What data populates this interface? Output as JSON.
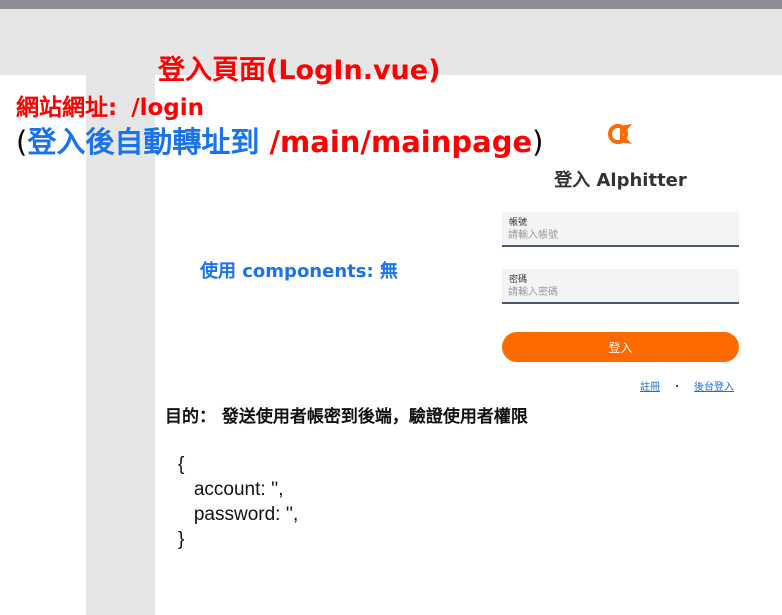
{
  "page": {
    "title": "登入頁面(LogIn.vue)",
    "url_label": "網站網址:",
    "url_value": "/login",
    "redirect_open": "(",
    "redirect_text": "登入後自動轉址到",
    "redirect_path": "/main/mainpage",
    "redirect_close": ")",
    "components_note": "使用 components: 無",
    "purpose": "目的： 發送使用者帳密到後端，驗證使用者權限",
    "code_lines": [
      "{",
      "   account: '',",
      "   password: '',",
      "}"
    ]
  },
  "login": {
    "logo_icon": "alphitter-logo-icon",
    "brand_title": "登入 Alphitter",
    "account_label": "帳號",
    "account_placeholder": "請輸入帳號",
    "password_label": "密碼",
    "password_placeholder": "請輸入密碼",
    "submit_label": "登入",
    "register_link": "註冊",
    "separator": "・",
    "admin_link": "後台登入"
  },
  "colors": {
    "accent": "#ff6a00",
    "note_red": "#ff0000",
    "note_blue": "#1a73e8"
  }
}
